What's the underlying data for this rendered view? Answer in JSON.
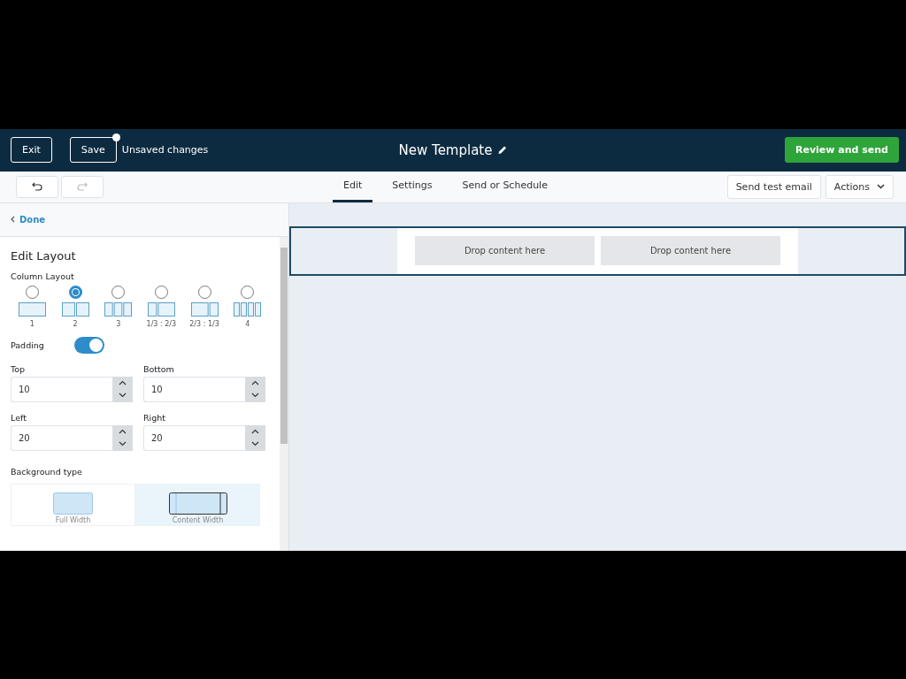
{
  "header": {
    "exit": "Exit",
    "save": "Save",
    "unsaved_dot": true,
    "status": "Unsaved changes",
    "title": "New Template",
    "primary": "Review and send"
  },
  "toolbar": {
    "undo_disabled": false,
    "redo_disabled": true,
    "tabs": [
      {
        "label": "Edit",
        "selected": true
      },
      {
        "label": "Settings",
        "selected": false
      },
      {
        "label": "Send or Schedule",
        "selected": false
      }
    ],
    "test": "Send test email",
    "actions": "Actions"
  },
  "panel": {
    "back": "Done",
    "title": "Edit Layout",
    "layout_label": "Column Layout",
    "layouts": [
      {
        "label": "1",
        "kind": "single",
        "selected": false
      },
      {
        "label": "2",
        "kind": "halves",
        "selected": true
      },
      {
        "label": "3",
        "kind": "thirds",
        "selected": false
      },
      {
        "label": "1/3 : 2/3",
        "kind": "narrowwide",
        "selected": false
      },
      {
        "label": "2/3 : 1/3",
        "kind": "widenarrow",
        "selected": false
      },
      {
        "label": "4",
        "kind": "quarters",
        "selected": false
      }
    ],
    "padding_label": "Padding",
    "padding_on": true,
    "fields": [
      {
        "label": "Top",
        "value": "10"
      },
      {
        "label": "Bottom",
        "value": "10"
      },
      {
        "label": "Left",
        "value": "20"
      },
      {
        "label": "Right",
        "value": "20"
      }
    ],
    "background_label": "Background type",
    "backgrounds": [
      {
        "label": "Full Width",
        "kind": "full",
        "selected": false
      },
      {
        "label": "Content Width",
        "kind": "content",
        "selected": true
      }
    ]
  },
  "canvas": {
    "zones": [
      "Drop content here",
      "Drop content here"
    ]
  }
}
